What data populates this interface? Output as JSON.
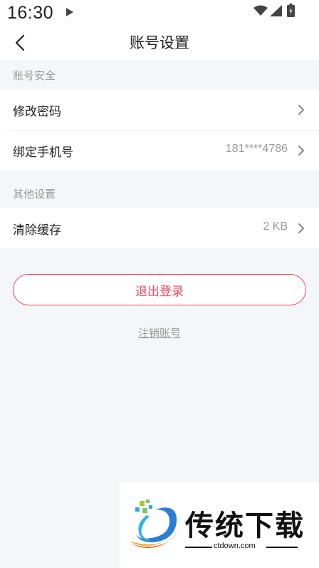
{
  "status_bar": {
    "time": "16:30",
    "icons": [
      "play-icon",
      "wifi-icon",
      "signal-icon",
      "battery-icon"
    ]
  },
  "nav": {
    "title": "账号设置",
    "back_icon": "chevron-left-icon"
  },
  "sections": [
    {
      "header": "账号安全",
      "rows": [
        {
          "label": "修改密码",
          "value": ""
        },
        {
          "label": "绑定手机号",
          "value": "181****4786"
        }
      ]
    },
    {
      "header": "其他设置",
      "rows": [
        {
          "label": "清除缓存",
          "value": "2 KB"
        }
      ]
    }
  ],
  "actions": {
    "logout_label": "退出登录",
    "cancel_account_label": "注销账号"
  },
  "watermark": {
    "text": "传统下载",
    "domain": "ctdown.com"
  },
  "colors": {
    "accent": "#e8475c",
    "background": "#f5f6fa",
    "muted_text": "#999999"
  }
}
